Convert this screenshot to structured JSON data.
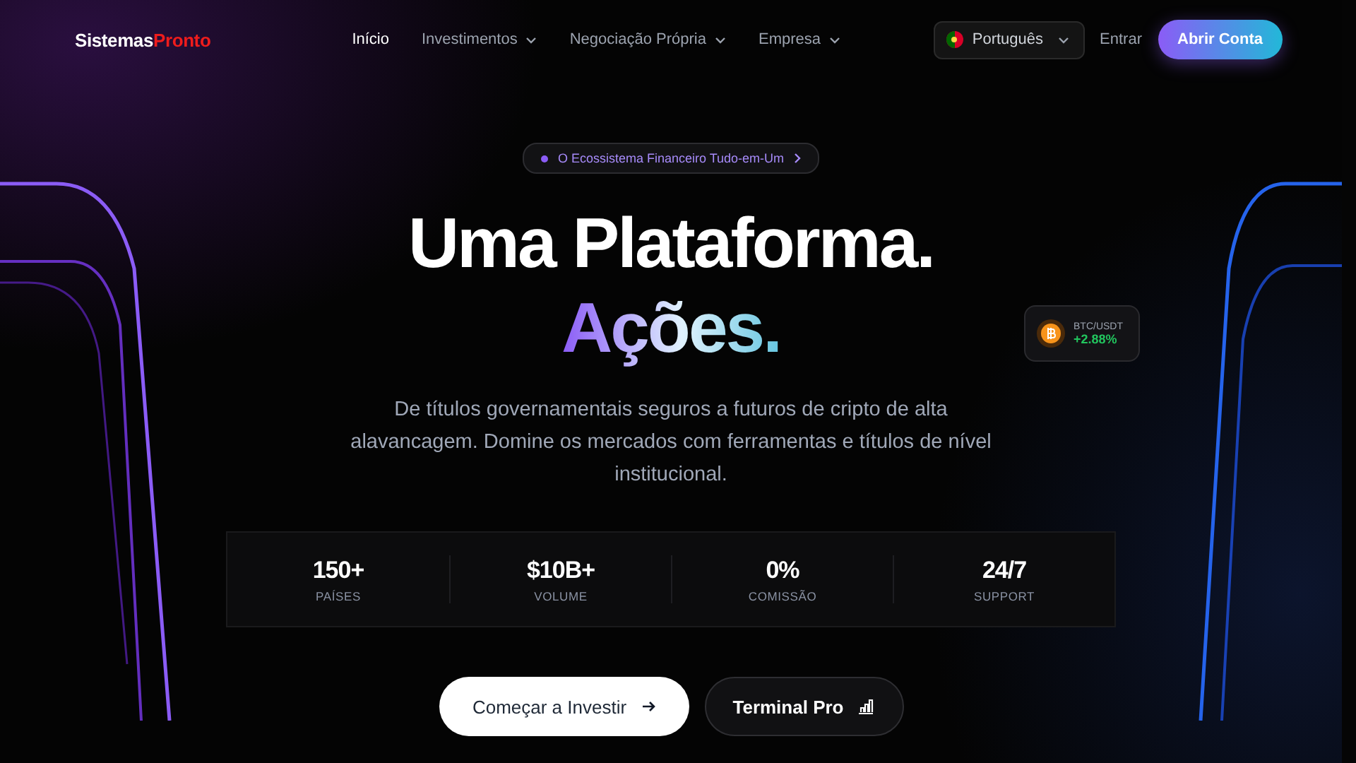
{
  "header": {
    "logo": {
      "part_1": "Sistemas",
      "part_2": "Pronto"
    },
    "nav_links": [
      {
        "label": "Início",
        "selected": true,
        "dropdown": false
      },
      {
        "label": "Investimentos",
        "selected": false,
        "dropdown": true
      },
      {
        "label": "Negociação Própria",
        "selected": false,
        "dropdown": true
      },
      {
        "label": "Empresa",
        "selected": false,
        "dropdown": true
      }
    ],
    "language": "Português",
    "login": "Entrar",
    "signup": "Abrir Conta"
  },
  "hero": {
    "badge": "O Ecossistema Financeiro Tudo-em-Um",
    "title_line_1": "Uma Plataforma.",
    "title_line_2": "Ações.",
    "description": "De títulos governamentais seguros a futuros de cripto de alta alavancagem. Domine os mercados com ferramentas e títulos de nível institucional.",
    "ticker": {
      "pair": "BTC/USDT",
      "change": "+2.88%"
    },
    "stats": [
      {
        "value": "150+",
        "label": "PAÍSES"
      },
      {
        "value": "$10B+",
        "label": "VOLUME"
      },
      {
        "value": "0%",
        "label": "COMISSÃO"
      },
      {
        "value": "24/7",
        "label": "SUPPORT"
      }
    ],
    "buttons": [
      {
        "kind": "primary",
        "label": "Começar a Investir"
      },
      {
        "kind": "secondary",
        "label": "Terminal Pro"
      }
    ]
  }
}
